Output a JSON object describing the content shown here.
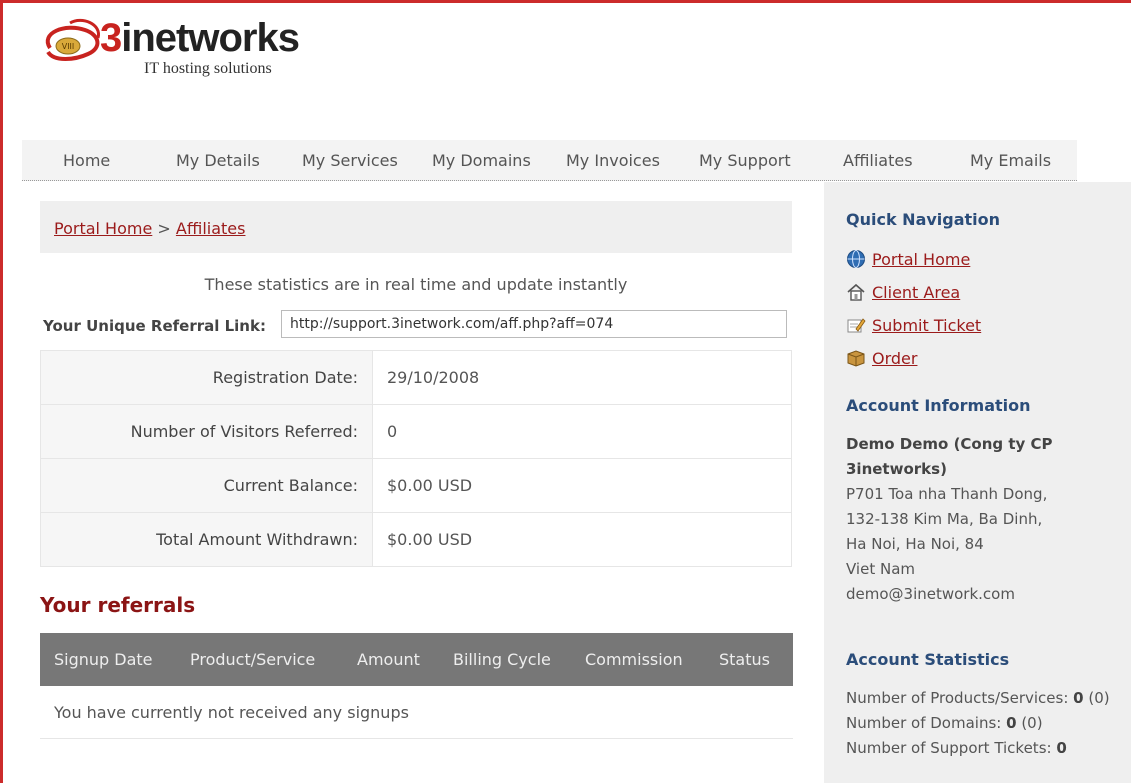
{
  "brand": {
    "badge": "VIII",
    "name_accent": "3",
    "name_rest": "inetworks",
    "tagline": "IT hosting solutions"
  },
  "nav": [
    {
      "label": "Home"
    },
    {
      "label": "My Details"
    },
    {
      "label": "My Services"
    },
    {
      "label": "My Domains"
    },
    {
      "label": "My Invoices"
    },
    {
      "label": "My Support"
    },
    {
      "label": "Affiliates"
    },
    {
      "label": "My Emails"
    }
  ],
  "breadcrumb": {
    "home": "Portal Home",
    "sep": ">",
    "current": "Affiliates"
  },
  "note": "These statistics are in real time and update instantly",
  "referral": {
    "label": "Your Unique Referral Link:",
    "value": "http://support.3inetwork.com/aff.php?aff=074"
  },
  "stats": [
    {
      "label": "Registration Date:",
      "value": "29/10/2008"
    },
    {
      "label": "Number of Visitors Referred:",
      "value": "0"
    },
    {
      "label": "Current Balance:",
      "value": "$0.00 USD"
    },
    {
      "label": "Total Amount Withdrawn:",
      "value": "$0.00 USD"
    }
  ],
  "referrals": {
    "title": "Your referrals",
    "columns": [
      "Signup Date",
      "Product/Service",
      "Amount",
      "Billing Cycle",
      "Commission",
      "Status"
    ],
    "empty": "You have currently not received any signups"
  },
  "sidebar": {
    "quick_nav_title": "Quick Navigation",
    "links": [
      {
        "label": "Portal Home",
        "icon": "globe-icon"
      },
      {
        "label": "Client Area",
        "icon": "house-icon"
      },
      {
        "label": "Submit Ticket",
        "icon": "edit-icon"
      },
      {
        "label": "Order",
        "icon": "box-icon"
      }
    ],
    "account_title": "Account Information",
    "account": {
      "name": "Demo Demo (Cong ty CP 3inetworks)",
      "address1": "P701 Toa nha Thanh Dong,",
      "address2": "132-138 Kim Ma, Ba Dinh,",
      "address3": "Ha Noi, Ha Noi, 84",
      "country": "Viet Nam",
      "email": "demo@3inetwork.com"
    },
    "stats_title": "Account Statistics",
    "account_stats": [
      {
        "label": "Number of Products/Services:",
        "value": "0",
        "extra": "(0)"
      },
      {
        "label": "Number of Domains:",
        "value": "0",
        "extra": "(0)"
      },
      {
        "label": "Number of Support Tickets:",
        "value": "0",
        "extra": ""
      }
    ]
  },
  "colors": {
    "accent": "#9b1b1b",
    "nav_bg": "#f3f3f3",
    "sidebar_bg": "#efefef",
    "table_head": "#777777",
    "frame": "#cc2b2b"
  }
}
